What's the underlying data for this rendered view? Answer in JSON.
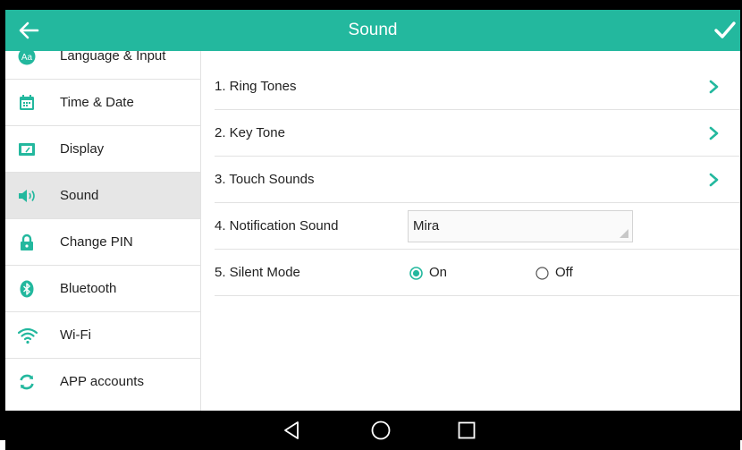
{
  "header": {
    "title": "Sound",
    "back_icon": "arrow-left-icon",
    "confirm_icon": "checkmark-icon"
  },
  "colors": {
    "accent": "#23b89e",
    "active_item_bg": "#e6e6e6",
    "divider": "#e2e2e2",
    "navbar": "#000000"
  },
  "sidebar": {
    "items": [
      {
        "label": "Language & Input",
        "icon": "language-icon"
      },
      {
        "label": "Time & Date",
        "icon": "calendar-icon"
      },
      {
        "label": "Display",
        "icon": "display-icon"
      },
      {
        "label": "Sound",
        "icon": "speaker-icon",
        "active": true
      },
      {
        "label": "Change PIN",
        "icon": "lock-icon"
      },
      {
        "label": "Bluetooth",
        "icon": "bluetooth-icon"
      },
      {
        "label": "Wi-Fi",
        "icon": "wifi-icon"
      },
      {
        "label": "APP accounts",
        "icon": "sync-icon"
      }
    ]
  },
  "settings": {
    "ring_tones": "1. Ring Tones",
    "key_tone": "2. Key Tone",
    "touch_sounds": "3. Touch Sounds",
    "notification_sound": {
      "label": "4. Notification Sound",
      "value": "Mira"
    },
    "silent_mode": {
      "label": "5. Silent Mode",
      "on_label": "On",
      "off_label": "Off",
      "selected": "On"
    }
  },
  "navbar": {
    "icons": [
      "back-triangle-icon",
      "home-circle-icon",
      "recents-square-icon"
    ]
  }
}
